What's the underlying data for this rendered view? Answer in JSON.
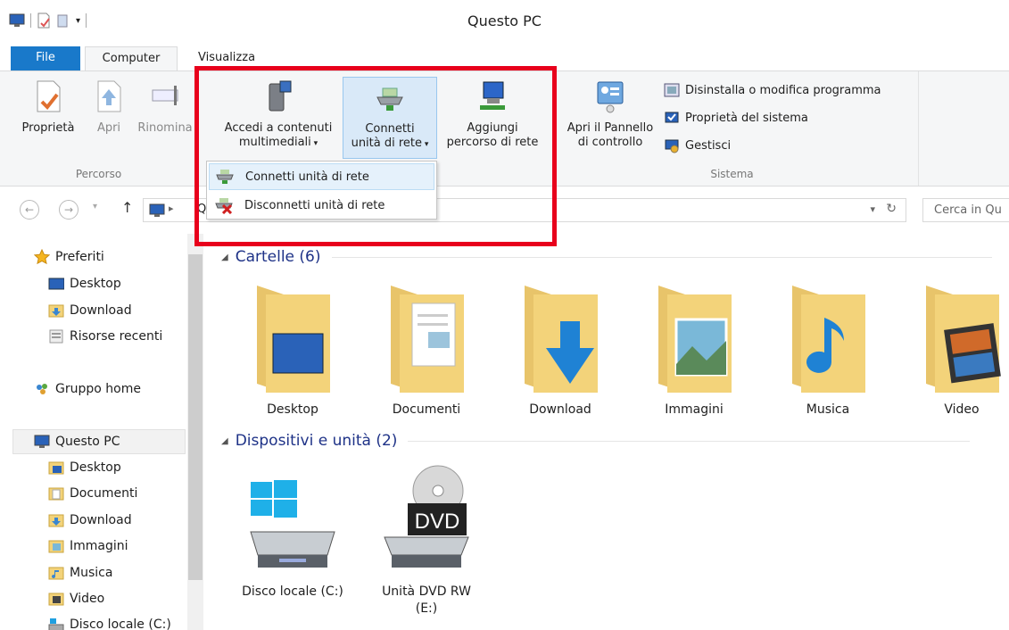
{
  "window": {
    "title": "Questo PC"
  },
  "tabs": {
    "file": "File",
    "computer": "Computer",
    "view": "Visualizza"
  },
  "ribbon": {
    "percorso": {
      "label": "Percorso",
      "properties": "Proprietà",
      "open": "Apri",
      "rename": "Rinomina"
    },
    "network": {
      "media_line1": "Accedi a contenuti",
      "media_line2": "multimediali",
      "map_line1": "Connetti",
      "map_line2": "unità di rete",
      "add_line1": "Aggiungi",
      "add_line2": "percorso di rete"
    },
    "sistema": {
      "label": "Sistema",
      "control_line1": "Apri il Pannello",
      "control_line2": "di controllo",
      "uninstall": "Disinstalla o modifica programma",
      "system_properties": "Proprietà del sistema",
      "manage": "Gestisci"
    }
  },
  "dropdown": {
    "items": [
      {
        "label": "Connetti unità di rete"
      },
      {
        "label": "Disconnetti unità di rete"
      }
    ]
  },
  "address": {
    "path_fragment": "Q",
    "search_placeholder": "Cerca in Qu"
  },
  "sidebar": {
    "favorites": "Preferiti",
    "fav_items": [
      "Desktop",
      "Download",
      "Risorse recenti"
    ],
    "homegroup": "Gruppo home",
    "this_pc": "Questo PC",
    "pc_items": [
      "Desktop",
      "Documenti",
      "Download",
      "Immagini",
      "Musica",
      "Video",
      "Disco locale (C:)"
    ]
  },
  "content": {
    "folders_header": "Cartelle (6)",
    "folders": [
      "Desktop",
      "Documenti",
      "Download",
      "Immagini",
      "Musica",
      "Video"
    ],
    "devices_header": "Dispositivi e unità (2)",
    "devices": [
      {
        "line1": "Disco locale (C:)",
        "line2": ""
      },
      {
        "line1": "Unità DVD RW",
        "line2": "(E:)"
      }
    ],
    "dvd_badge": "DVD"
  },
  "colors": {
    "accent": "#1979ca",
    "highlight_border": "#e8001c",
    "section_text": "#1e3287",
    "folder": "#f3d37a"
  }
}
